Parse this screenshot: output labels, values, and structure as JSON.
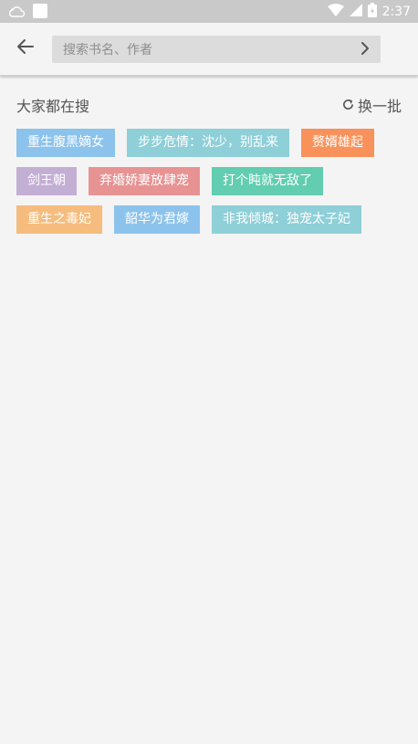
{
  "status_bar": {
    "time": "2:37",
    "icons": [
      "cloud-notification-icon",
      "app-notification-icon",
      "wifi-icon",
      "signal-icon",
      "battery-icon"
    ]
  },
  "header": {
    "back_icon": "arrow-left-icon",
    "search": {
      "placeholder": "搜索书名、作者",
      "value": ""
    },
    "go_icon": "chevron-right-icon"
  },
  "hot_search": {
    "title": "大家都在搜",
    "refresh_label": "换一批",
    "refresh_icon": "refresh-icon",
    "tags": [
      {
        "label": "重生腹黑嫡女",
        "color": "#8cc3ec"
      },
      {
        "label": "步步危情：沈少，别乱来",
        "color": "#8ecfd8"
      },
      {
        "label": "赘婿雄起",
        "color": "#f8925a"
      },
      {
        "label": "剑王朝",
        "color": "#c3aed4"
      },
      {
        "label": "弃婚娇妻放肆宠",
        "color": "#e89393"
      },
      {
        "label": "打个盹就无敌了",
        "color": "#62cdb0"
      },
      {
        "label": "重生之毒妃",
        "color": "#f6bc7d"
      },
      {
        "label": "韶华为君嫁",
        "color": "#8cc3ec"
      },
      {
        "label": "非我倾城：独宠太子妃",
        "color": "#8ecfd8"
      }
    ]
  }
}
